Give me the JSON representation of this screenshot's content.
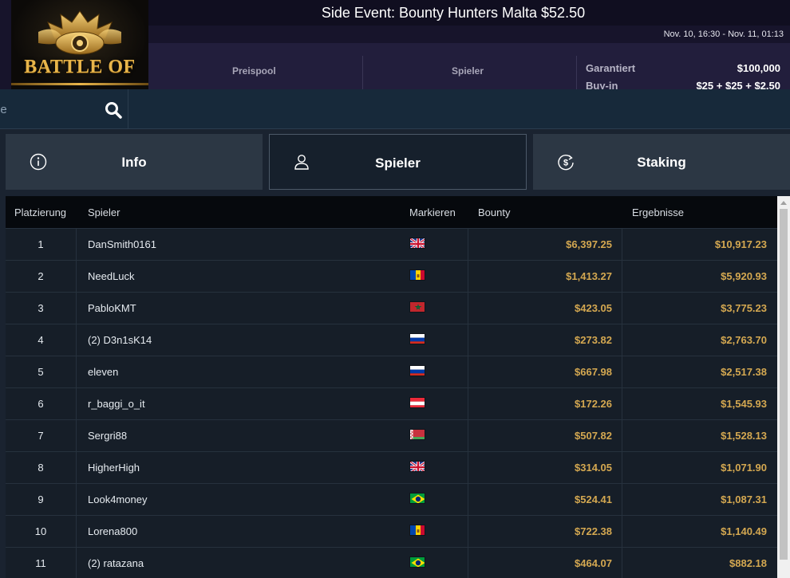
{
  "logo": {
    "text": "BATTLE OF"
  },
  "event": {
    "title": "Side Event: Bounty Hunters Malta $52.50",
    "dates": "Nov. 10, 16:30 - Nov. 11, 01:13"
  },
  "stats": {
    "prizepool_label": "Preispool",
    "players_label": "Spieler",
    "guaranteed_label": "Garantiert",
    "guaranteed_value": "$100,000",
    "buyin_label": "Buy-in",
    "buyin_value": "$25 + $25 + $2.50"
  },
  "search": {
    "placeholder": "ne",
    "icon": "search-icon"
  },
  "tabs": [
    {
      "label": "Info",
      "icon": "info-icon",
      "active": false
    },
    {
      "label": "Spieler",
      "icon": "user-icon",
      "active": true
    },
    {
      "label": "Staking",
      "icon": "dollar-cycle-icon",
      "active": false
    }
  ],
  "table": {
    "headers": {
      "rank": "Platzierung",
      "player": "Spieler",
      "flag": "Markieren",
      "bounty": "Bounty",
      "result": "Ergebnisse"
    },
    "rows": [
      {
        "rank": "1",
        "player": "DanSmith0161",
        "flag": "gb",
        "bounty": "$6,397.25",
        "result": "$10,917.23"
      },
      {
        "rank": "2",
        "player": "NeedLuck",
        "flag": "md",
        "bounty": "$1,413.27",
        "result": "$5,920.93"
      },
      {
        "rank": "3",
        "player": "PabloKMT",
        "flag": "ma",
        "bounty": "$423.05",
        "result": "$3,775.23"
      },
      {
        "rank": "4",
        "player": "(2) D3n1sK14",
        "flag": "ru",
        "bounty": "$273.82",
        "result": "$2,763.70"
      },
      {
        "rank": "5",
        "player": "eleven",
        "flag": "ru",
        "bounty": "$667.98",
        "result": "$2,517.38"
      },
      {
        "rank": "6",
        "player": "r_baggi_o_it",
        "flag": "at",
        "bounty": "$172.26",
        "result": "$1,545.93"
      },
      {
        "rank": "7",
        "player": "Sergri88",
        "flag": "by",
        "bounty": "$507.82",
        "result": "$1,528.13"
      },
      {
        "rank": "8",
        "player": "HigherHigh",
        "flag": "gb",
        "bounty": "$314.05",
        "result": "$1,071.90"
      },
      {
        "rank": "9",
        "player": "Look4money",
        "flag": "br",
        "bounty": "$524.41",
        "result": "$1,087.31"
      },
      {
        "rank": "10",
        "player": "Lorena800",
        "flag": "md",
        "bounty": "$722.38",
        "result": "$1,140.49"
      },
      {
        "rank": "11",
        "player": "(2) ratazana",
        "flag": "br",
        "bounty": "$464.07",
        "result": "$882.18"
      }
    ]
  },
  "colors": {
    "money": "#d4a851",
    "header_bg": "#17142b",
    "stats_bg": "#221e3c",
    "tab_bg": "#2c3744",
    "table_bg": "#161e28"
  }
}
